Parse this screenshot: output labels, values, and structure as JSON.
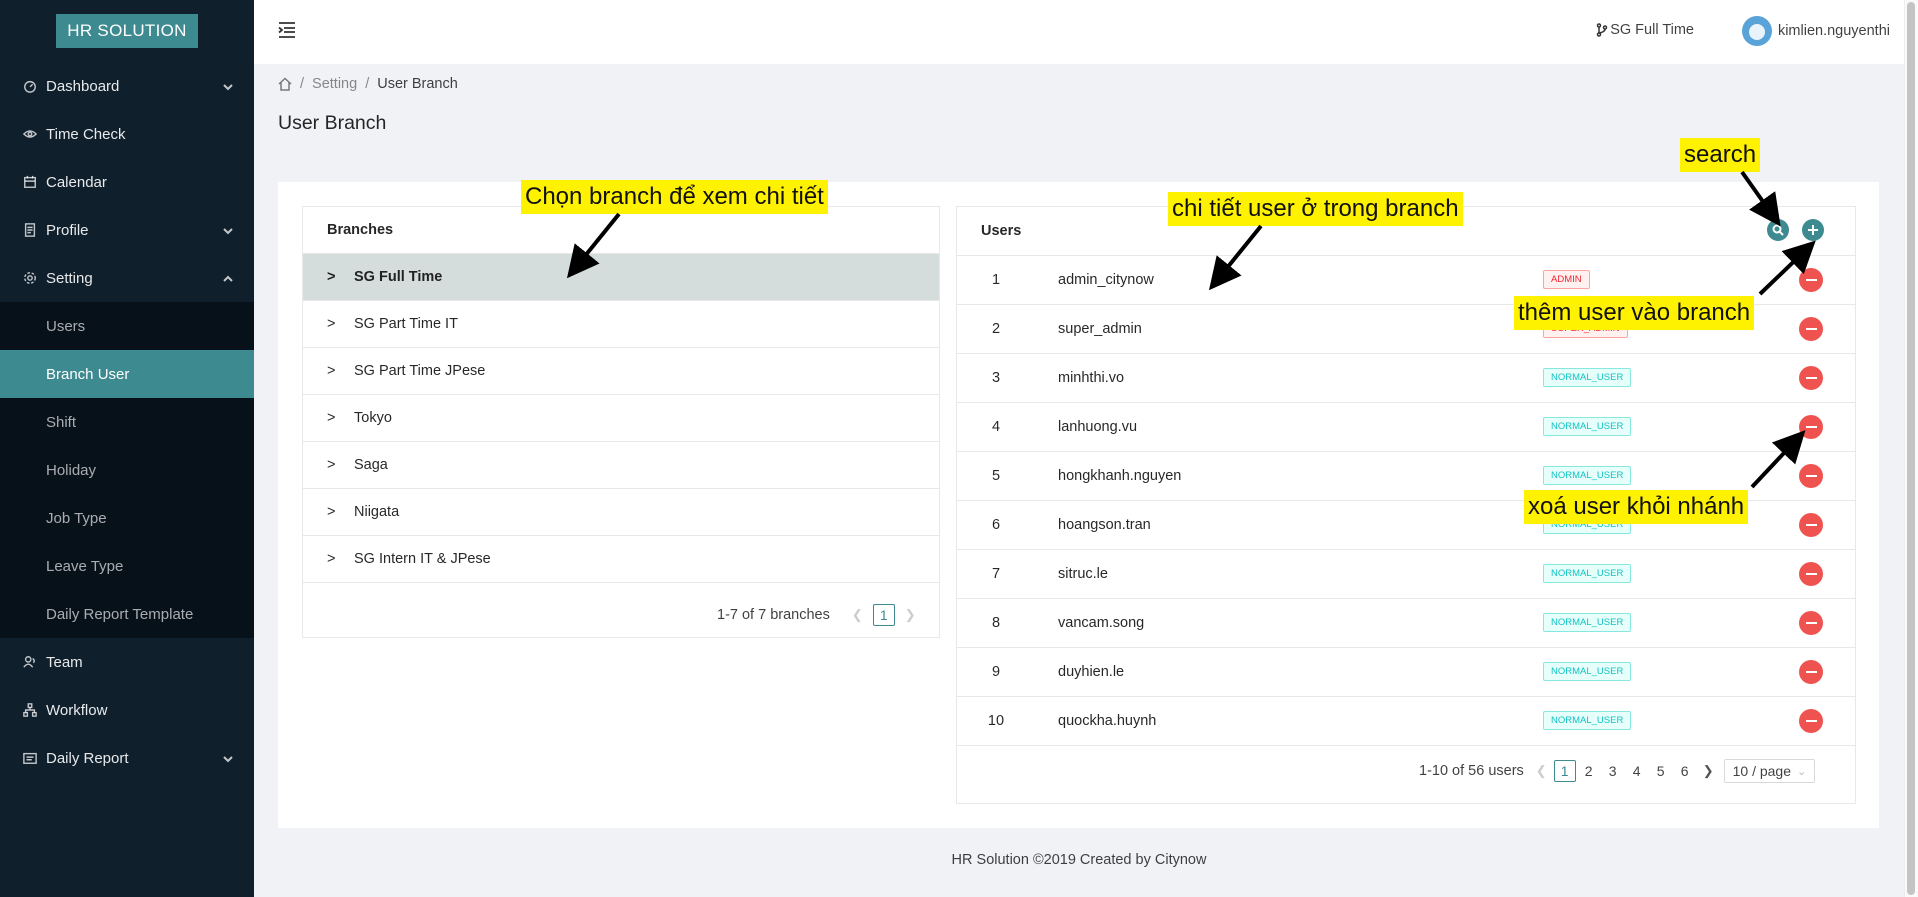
{
  "app": {
    "logo": "HR SOLUTION"
  },
  "sidebar": {
    "items": [
      {
        "label": "Dashboard",
        "icon": "dashboard-icon",
        "chevron": "down"
      },
      {
        "label": "Time Check",
        "icon": "eye-icon"
      },
      {
        "label": "Calendar",
        "icon": "calendar-icon"
      },
      {
        "label": "Profile",
        "icon": "profile-icon",
        "chevron": "down"
      },
      {
        "label": "Setting",
        "icon": "gear-icon",
        "chevron": "up"
      }
    ],
    "setting_sub": [
      "Users",
      "Branch User",
      "Shift",
      "Holiday",
      "Job Type",
      "Leave Type",
      "Daily Report Template"
    ],
    "active_sub": "Branch User",
    "bottom_items": [
      {
        "label": "Team",
        "icon": "team-icon"
      },
      {
        "label": "Workflow",
        "icon": "workflow-icon"
      },
      {
        "label": "Daily Report",
        "icon": "report-icon",
        "chevron": "down"
      }
    ]
  },
  "header": {
    "branch": "SG Full Time",
    "username": "kimlien.nguyenthi"
  },
  "breadcrumb": {
    "sep": "/",
    "items": [
      "Setting",
      "User Branch"
    ]
  },
  "page_title": "User Branch",
  "branches": {
    "title": "Branches",
    "items": [
      "SG Full Time",
      "SG Part Time IT",
      "SG Part Time JPese",
      "Tokyo",
      "Saga",
      "Niigata",
      "SG Intern IT & JPese"
    ],
    "selected": "SG Full Time",
    "prefix": ">",
    "pagination": {
      "summary": "1-7 of 7 branches",
      "pages": [
        "1"
      ],
      "current": "1"
    }
  },
  "users": {
    "title": "Users",
    "rows": [
      {
        "no": "1",
        "username": "admin_citynow",
        "role": "ADMIN",
        "color": "red"
      },
      {
        "no": "2",
        "username": "super_admin",
        "role": "SUPER_ADMIN",
        "color": "red"
      },
      {
        "no": "3",
        "username": "minhthi.vo",
        "role": "NORMAL_USER",
        "color": "cyan"
      },
      {
        "no": "4",
        "username": "lanhuong.vu",
        "role": "NORMAL_USER",
        "color": "cyan"
      },
      {
        "no": "5",
        "username": "hongkhanh.nguyen",
        "role": "NORMAL_USER",
        "color": "cyan"
      },
      {
        "no": "6",
        "username": "hoangson.tran",
        "role": "NORMAL_USER",
        "color": "cyan"
      },
      {
        "no": "7",
        "username": "sitruc.le",
        "role": "NORMAL_USER",
        "color": "cyan"
      },
      {
        "no": "8",
        "username": "vancam.song",
        "role": "NORMAL_USER",
        "color": "cyan"
      },
      {
        "no": "9",
        "username": "duyhien.le",
        "role": "NORMAL_USER",
        "color": "cyan"
      },
      {
        "no": "10",
        "username": "quockha.huynh",
        "role": "NORMAL_USER",
        "color": "cyan"
      }
    ],
    "pagination": {
      "summary": "1-10 of 56 users",
      "pages": [
        "1",
        "2",
        "3",
        "4",
        "5",
        "6"
      ],
      "current": "1",
      "page_size": "10 / page"
    }
  },
  "footer": "HR Solution ©2019 Created by Citynow",
  "annotations": {
    "choose_branch": "Chọn branch để xem chi tiết",
    "user_detail": "chi tiết user ở trong branch",
    "search": "search",
    "add_user": "thêm user vào branch",
    "remove_user": "xoá user khỏi nhánh"
  },
  "colors": {
    "sidebar_bg": "#0f1f2c",
    "accent": "#3d8a90",
    "delete": "#ef5350",
    "annotation_bg": "#fff200"
  }
}
